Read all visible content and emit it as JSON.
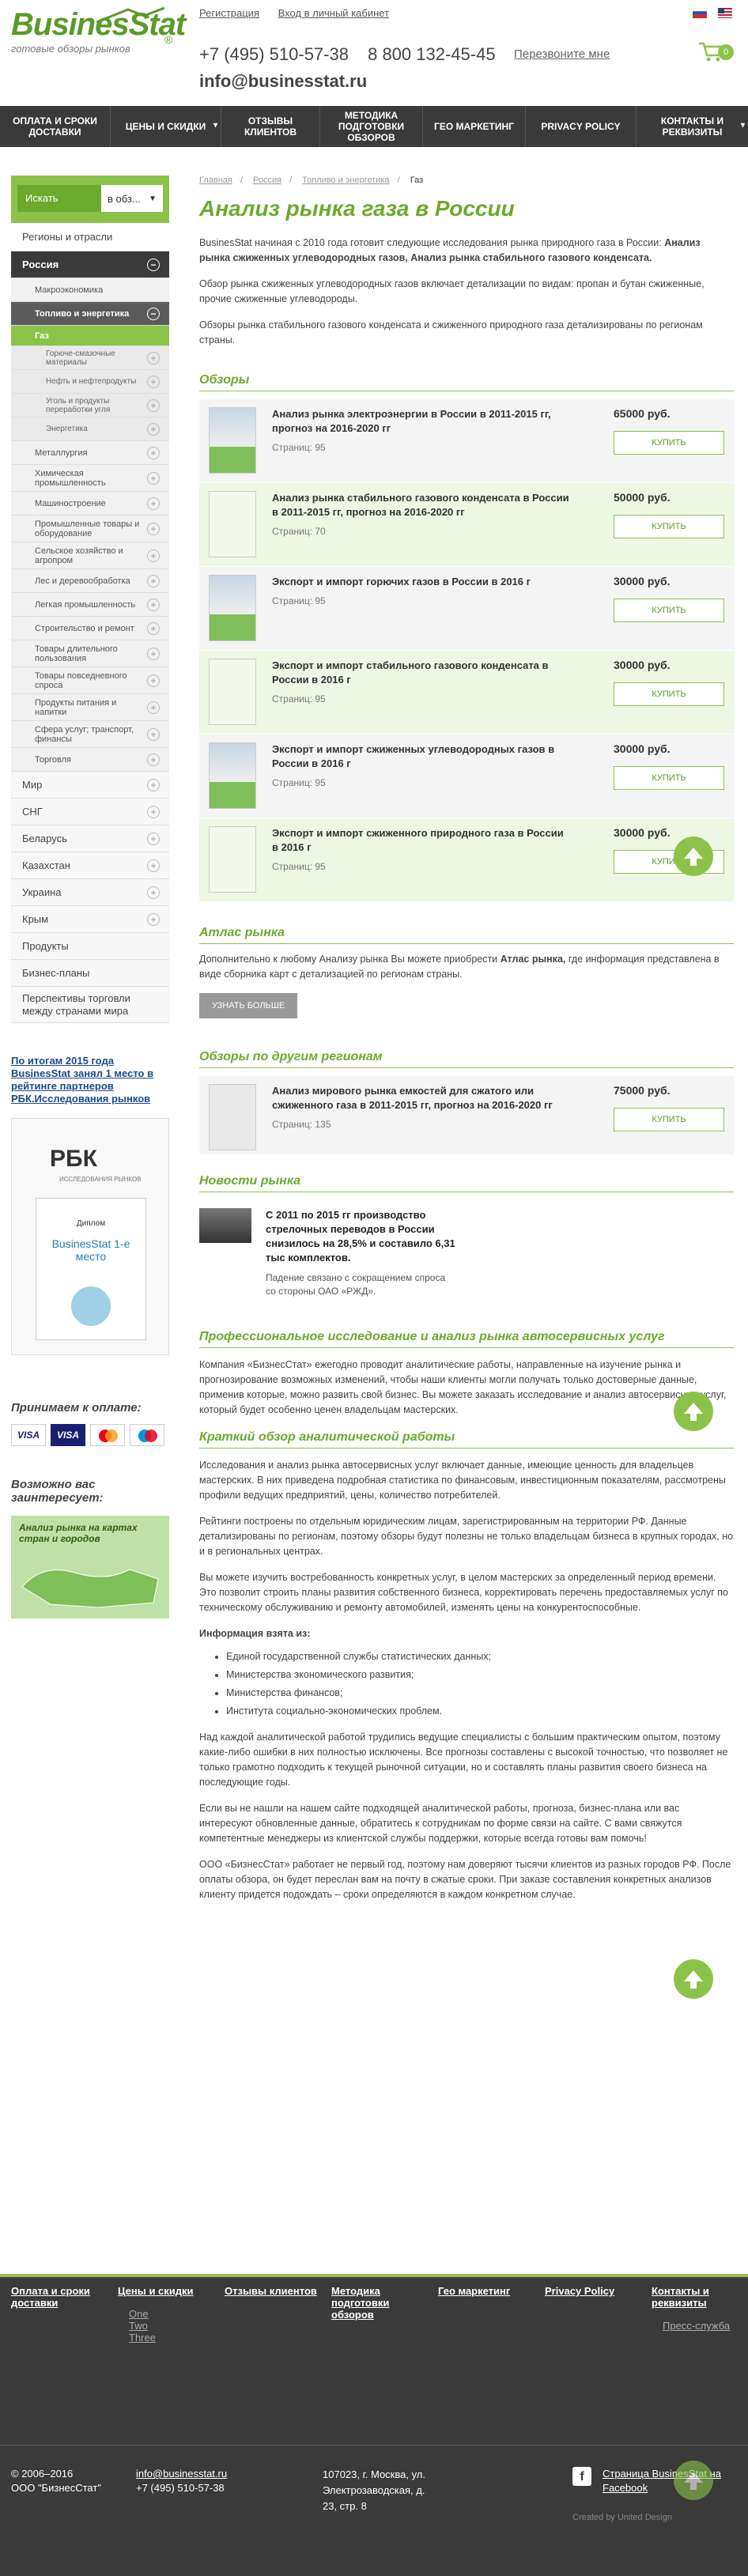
{
  "header": {
    "logo": "BusinesStat",
    "logo_reg": "®",
    "tagline": "готовые обзоры рынков",
    "register": "Регистрация",
    "login": "Вход в личный кабинет",
    "phone1": "+7 (495) 510-57-38",
    "phone2": "8 800 132-45-45",
    "callback": "Перезвоните мне",
    "email": "info@businesstat.ru",
    "cart_count": "0"
  },
  "nav": [
    "ОПЛАТА И СРОКИ ДОСТАВКИ",
    "ЦЕНЫ И СКИДКИ",
    "ОТЗЫВЫ КЛИЕНТОВ",
    "МЕТОДИКА ПОДГОТОВКИ ОБЗОРОВ",
    "ГЕО МАРКЕТИНГ",
    "PRIVACY POLICY",
    "КОНТАКТЫ И РЕКВИЗИТЫ"
  ],
  "search": {
    "label": "Искать",
    "scope": "в обз..."
  },
  "sidebar": {
    "regions": "Регионы и отрасли",
    "russia": "Россия",
    "macro": "Макроэкономика",
    "fuel": "Топливо и энергетика",
    "gas": "Газ",
    "fuel_subs": [
      "Горюче-смазочные материалы",
      "Нефть и нефтепродукты",
      "Уголь и продукты переработки угля",
      "Энергетика"
    ],
    "sectors": [
      "Металлургия",
      "Химическая промышленность",
      "Машиностроение",
      "Промышленные товары и оборудование",
      "Сельское хозяйство и агропром",
      "Лес и деревообработка",
      "Легкая промышленность",
      "Строительство и ремонт",
      "Товары длительного пользования",
      "Товары повседневного спроса",
      "Продукты питания и напитки",
      "Сфера услуг; транспорт, финансы",
      "Торговля"
    ],
    "countries": [
      "Мир",
      "СНГ",
      "Беларусь",
      "Казахстан",
      "Украина",
      "Крым"
    ],
    "extra": [
      "Продукты",
      "Бизнес-планы",
      "Перспективы торговли между странами мира"
    ]
  },
  "award": {
    "text": "По итогам 2015 года BusinesStat занял 1 место в рейтинге партнеров РБК.Исследования рынков",
    "rbk": "РБК",
    "rbk_sub": "ИССЛЕДОВАНИЯ РЫНКОВ",
    "diploma": "Диплом",
    "place": "BusinesStat 1-е место"
  },
  "payment": {
    "title": "Принимаем к оплате:",
    "cards": [
      "VISA",
      "VISA",
      "MC",
      "Maestro"
    ]
  },
  "interest": {
    "title": "Возможно вас заинтересует:",
    "promo": "Анализ рынка на картах стран и городов"
  },
  "breadcrumb": [
    "Главная",
    "Россия",
    "Топливо и энергетика",
    "Газ"
  ],
  "title": "Анализ рынка газа в России",
  "intro1": "BusinesStat начиная с 2010 года готовит следующие исследования рынка природного газа в России:",
  "intro1_bold": "Анализ рынка сжиженных углеводородных газов, Анализ рынка стабильного газового конденсата.",
  "intro2": "Обзор рынка сжиженных углеводородных газов включает детализации по видам: пропан и бутан сжиженные, прочие сжиженные углеводороды.",
  "intro3": "Обзоры рынка стабильного газового конденсата и сжиженного природного газа детализированы по регионам страны.",
  "reviews_title": "Обзоры",
  "reviews": [
    {
      "title": "Анализ рынка электроэнергии в России в 2011-2015 гг, прогноз на 2016-2020 гг",
      "pages": "Страниц: 95",
      "price": "65000 руб.",
      "buy": "КУПИТЬ"
    },
    {
      "title": "Анализ рынка стабильного газового конденсата в России в 2011-2015 гг, прогноз на 2016-2020 гг",
      "pages": "Страниц: 70",
      "price": "50000 руб.",
      "buy": "КУПИТЬ"
    },
    {
      "title": "Экспорт и импорт горючих газов в России в 2016 г",
      "pages": "Страниц: 95",
      "price": "30000 руб.",
      "buy": "КУПИТЬ"
    },
    {
      "title": "Экспорт и импорт стабильного газового конденсата в России в 2016 г",
      "pages": "Страниц: 95",
      "price": "30000 руб.",
      "buy": "КУПИТЬ"
    },
    {
      "title": "Экспорт и импорт сжиженных углеводородных газов в России в 2016 г",
      "pages": "Страниц: 95",
      "price": "30000 руб.",
      "buy": "КУПИТЬ"
    },
    {
      "title": "Экспорт и импорт сжиженного природного газа в России в 2016 г",
      "pages": "Страниц: 95",
      "price": "30000 руб.",
      "buy": "КУПИТЬ"
    }
  ],
  "atlas": {
    "title": "Атлас рынка",
    "text": "Дополнительно к любому Анализу рынка Вы можете приобрести",
    "bold": "Атлас рынка,",
    "text2": "где информация представлена в виде сборника карт с детализацией по регионам страны.",
    "btn": "УЗНАТЬ БОЛЬШЕ"
  },
  "other": {
    "title": "Обзоры по другим регионам",
    "item": {
      "title": "Анализ мирового рынка емкостей для сжатого или сжиженного газа в 2011-2015 гг, прогноз на 2016-2020 гг",
      "pages": "Страниц: 135",
      "price": "75000 руб.",
      "buy": "КУПИТЬ"
    }
  },
  "news": {
    "title": "Новости рынка",
    "headline": "С 2011 по 2015 гг производство стрелочных переводов в России снизилось на 28,5% и составило 6,31 тыс комплектов.",
    "body": "Падение связано с сокращением спроса со стороны ОАО «РЖД»."
  },
  "pro": {
    "title": "Профессиональное исследование и анализ рынка автосервисных услуг",
    "text": "Компания «БизнесСтат» ежегодно проводит аналитические работы, направленные на изучение рынка и прогнозирование возможных изменений, чтобы наши клиенты могли получать только достоверные данные, применив которые, можно развить свой бизнес. Вы можете заказать исследование и анализ автосервисных услуг, который будет особенно ценен владельцам мастерских."
  },
  "brief": {
    "title": "Краткий обзор аналитической работы",
    "p1": "Исследования и анализ рынка автосервисных услуг включает данные, имеющие ценность для владельцев мастерских. В них приведена подробная статистика по финансовым, инвестиционным показателям, рассмотрены профили ведущих предприятий, цены, количество потребителей.",
    "p2": "Рейтинги построены по отдельным юридическим лицам, зарегистрированным на территории РФ. Данные детализированы по регионам, поэтому обзоры будут полезны не только владельцам бизнеса в крупных городах, но и в региональных центрах.",
    "p3": "Вы можете изучить востребованность конкретных услуг, в целом мастерских за определенный период времени. Это позволит строить планы развития собственного бизнеса, корректировать перечень предоставляемых услуг по техническому обслуживанию и ремонту автомобилей, изменять цены на конкурентоспособные.",
    "src_title": "Информация взята из:",
    "sources": [
      "Единой государственной службы статистических данных;",
      "Министерства экономического развития;",
      "Министерства финансов;",
      "Института социально-экономических проблем."
    ],
    "p4": "Над каждой аналитической работой трудились ведущие специалисты с большим практическим опытом, поэтому какие-либо ошибки в них полностью исключены. Все прогнозы составлены с высокой точностью, что позволяет не только грамотно подходить к текущей рыночной ситуации, но и составлять планы развития своего бизнеса на последующие годы.",
    "p5": "Если вы не нашли на нашем сайте подходящей аналитической работы, прогноза, бизнес-плана или вас интересуют обновленные данные, обратитесь к сотрудникам по форме связи на сайте. С вами свяжутся компетентные менеджеры из клиентской службы поддержки, которые всегда готовы вам помочь!",
    "p6": "ООО «БизнесСтат» работает не первый год, поэтому нам доверяют тысячи клиентов из разных городов РФ. После оплаты обзора, он будет переслан вам на почту в сжатые сроки. При заказе составления конкретных анализов клиенту придется подождать – сроки определяются в каждом конкретном случае."
  },
  "footer": {
    "nav": [
      "Оплата и сроки доставки",
      "Цены и скидки",
      "Отзывы клиентов",
      "Методика подготовки обзоров",
      "Гео маркетинг",
      "Privacy Policy",
      "Контакты и реквизиты"
    ],
    "subs": [
      "One",
      "Two",
      "Three"
    ],
    "service": "Пресс-служба",
    "copy": "© 2006–2016",
    "company": "ООО \"БизнесСтат\"",
    "email": "info@businesstat.ru",
    "phone": "+7 (495) 510-57-38",
    "address": "107023, г. Москва, ул. Электрозаводская, д. 23, стр. 8",
    "fb": "Страница BusinesStat на Facebook",
    "credit": "Created by United Design"
  }
}
